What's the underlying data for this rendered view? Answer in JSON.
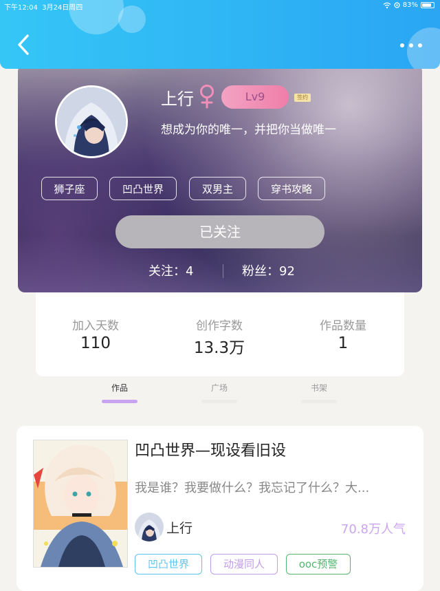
{
  "status_bar": {
    "time": "下午12:04",
    "date": "3月24日周四",
    "battery": "83%",
    "battery_level": 0.83
  },
  "profile": {
    "name": "上行",
    "gender_symbol": "♀",
    "level": "Lv9",
    "signed_badge": "签约",
    "motto": "想成为你的唯一，并把你当做唯一",
    "tags": [
      "狮子座",
      "凹凸世界",
      "双男主",
      "穿书攻略"
    ],
    "follow_button": "已关注",
    "following": "关注：4",
    "fans": "粉丝：92"
  },
  "stats": [
    {
      "label": "加入天数",
      "value": "110"
    },
    {
      "label": "创作字数",
      "value": "13.3万"
    },
    {
      "label": "作品数量",
      "value": "1"
    }
  ],
  "tabs": [
    {
      "label": "作品",
      "active": true
    },
    {
      "label": "广场",
      "active": false
    },
    {
      "label": "书架",
      "active": false
    }
  ],
  "book": {
    "title": "凹凸世界—现设看旧设",
    "description": "我是谁？我要做什么？我忘记了什么？大...",
    "author": "上行",
    "popularity": "70.8万人气",
    "tags": [
      "凹凸世界",
      "动漫同人",
      "ooc预警"
    ]
  },
  "colors": {
    "header": "#2fb4f5",
    "tab_active_bar": "#c7a3f0",
    "popularity": "#c9a6ef",
    "tag_blue": "#5ec4ef",
    "tag_purple": "#c29de6",
    "tag_green": "#52b66e"
  },
  "icons": [
    "back-chevron-icon",
    "more-dots-icon",
    "wifi-icon",
    "battery-icon",
    "female-icon"
  ]
}
